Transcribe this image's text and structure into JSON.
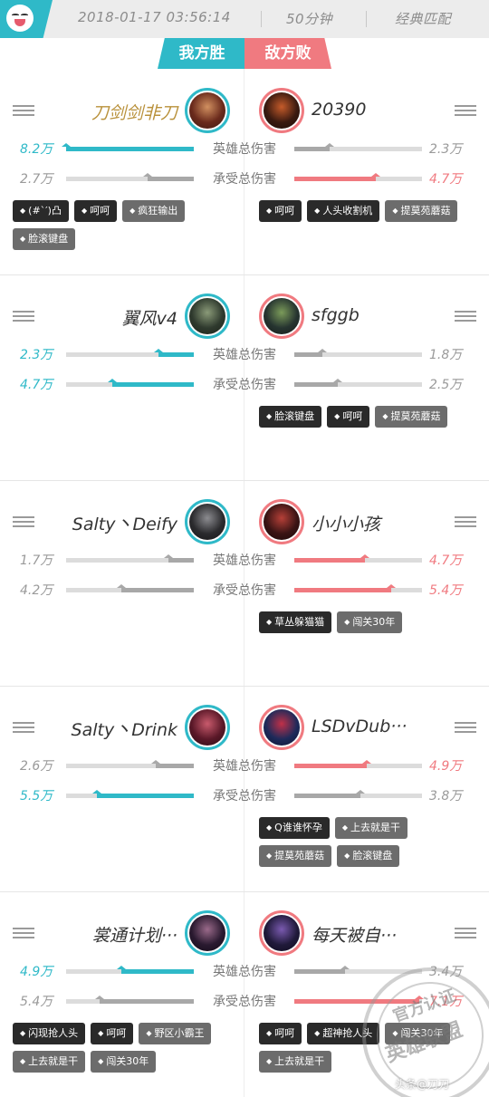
{
  "header": {
    "datetime": "2018-01-17 03:56:14",
    "duration": "50分钟",
    "mode": "经典匹配"
  },
  "tabs": {
    "win": "我方胜",
    "lose": "敌方败"
  },
  "stat_labels": {
    "damage": "英雄总伤害",
    "taken": "承受总伤害"
  },
  "colors": {
    "teal": "#2fb9c8",
    "red": "#f07a80",
    "grey": "#9a9a9a"
  },
  "rows": [
    {
      "left": {
        "name": "刀剑剑非刀",
        "damage": "8.2万",
        "damage_frac": 1.0,
        "damage_color": "teal",
        "taken": "2.7万",
        "taken_frac": 0.36,
        "taken_color": "grey",
        "tags": [
          [
            "(#`′)凸",
            "dark"
          ],
          [
            "呵呵",
            "dark"
          ],
          [
            "疯狂输出",
            "grey"
          ],
          [
            "脸滚键盘",
            "grey"
          ]
        ],
        "avatar_colors": [
          "#6a2a1c",
          "#d19060",
          "#3c1a12"
        ]
      },
      "right": {
        "name": "20390",
        "damage": "2.3万",
        "damage_frac": 0.28,
        "damage_color": "grey",
        "taken": "4.7万",
        "taken_frac": 0.64,
        "taken_color": "red",
        "tags": [
          [
            "呵呵",
            "dark"
          ],
          [
            "人头收割机",
            "dark"
          ],
          [
            "提莫苑蘑菇",
            "grey"
          ]
        ],
        "avatar_colors": [
          "#3a1a10",
          "#c55b2a",
          "#1b0c08"
        ]
      }
    },
    {
      "left": {
        "name": "翼风v4",
        "damage": "2.3万",
        "damage_frac": 0.28,
        "damage_color": "teal",
        "taken": "4.7万",
        "taken_frac": 0.64,
        "taken_color": "teal",
        "tags": [],
        "avatar_colors": [
          "#2f3a2e",
          "#8a9a78",
          "#1c2118"
        ]
      },
      "right": {
        "name": "sfggb",
        "damage": "1.8万",
        "damage_frac": 0.22,
        "damage_color": "grey",
        "taken": "2.5万",
        "taken_frac": 0.34,
        "taken_color": "grey",
        "tags": [
          [
            "脸滚键盘",
            "dark"
          ],
          [
            "呵呵",
            "dark"
          ],
          [
            "提莫苑蘑菇",
            "grey"
          ]
        ],
        "avatar_colors": [
          "#263430",
          "#7b9b5a",
          "#151c18"
        ]
      }
    },
    {
      "left": {
        "name": "Salty丶Deify",
        "damage": "1.7万",
        "damage_frac": 0.2,
        "damage_color": "grey",
        "taken": "4.2万",
        "taken_frac": 0.57,
        "taken_color": "grey",
        "tags": [],
        "avatar_colors": [
          "#2b2b2e",
          "#8c8c90",
          "#141416"
        ]
      },
      "right": {
        "name": "小小小孩",
        "damage": "4.7万",
        "damage_frac": 0.55,
        "damage_color": "red",
        "taken": "5.4万",
        "taken_frac": 0.76,
        "taken_color": "red",
        "tags": [
          [
            "草丛躲猫猫",
            "dark"
          ],
          [
            "闯关30年",
            "grey"
          ]
        ],
        "avatar_colors": [
          "#3a1414",
          "#b64038",
          "#1a0808"
        ]
      }
    },
    {
      "left": {
        "name": "Salty丶Drink",
        "damage": "2.6万",
        "damage_frac": 0.3,
        "damage_color": "grey",
        "taken": "5.5万",
        "taken_frac": 0.76,
        "taken_color": "teal",
        "tags": [],
        "avatar_colors": [
          "#5a1828",
          "#c85a6c",
          "#2a0c14"
        ]
      },
      "right": {
        "name": "LSDvDub···",
        "damage": "4.9万",
        "damage_frac": 0.57,
        "damage_color": "red",
        "taken": "3.8万",
        "taken_frac": 0.52,
        "taken_color": "grey",
        "tags": [
          [
            "Q谁谁怀孕",
            "dark"
          ],
          [
            "上去就是干",
            "grey"
          ],
          [
            "提莫苑蘑菇",
            "grey"
          ],
          [
            "脸滚键盘",
            "grey"
          ]
        ],
        "avatar_colors": [
          "#1e2a5a",
          "#c03048",
          "#0c1430"
        ]
      }
    },
    {
      "left": {
        "name": "裳通计划···",
        "damage": "4.9万",
        "damage_frac": 0.57,
        "damage_color": "teal",
        "taken": "5.4万",
        "taken_frac": 0.74,
        "taken_color": "grey",
        "tags": [
          [
            "闪现抢人头",
            "dark"
          ],
          [
            "呵呵",
            "dark"
          ],
          [
            "野区小霸王",
            "grey"
          ],
          [
            "上去就是干",
            "grey"
          ],
          [
            "闯关30年",
            "grey"
          ]
        ],
        "avatar_colors": [
          "#2a1a30",
          "#9a6a8a",
          "#120a16"
        ]
      },
      "right": {
        "name": "每天被自···",
        "damage": "3.4万",
        "damage_frac": 0.4,
        "damage_color": "grey",
        "taken": "7.1万",
        "taken_frac": 0.98,
        "taken_color": "red",
        "tags": [
          [
            "呵呵",
            "dark"
          ],
          [
            "超神抢人头",
            "dark"
          ],
          [
            "闯关30年",
            "grey"
          ],
          [
            "上去就是干",
            "grey"
          ]
        ],
        "avatar_colors": [
          "#201a3a",
          "#7a5ab0",
          "#0e0a1c"
        ]
      }
    }
  ],
  "watermark": {
    "stamp_line1": "官方认证",
    "stamp_line2": "英雄联盟",
    "caption": "头条@刀刀"
  }
}
